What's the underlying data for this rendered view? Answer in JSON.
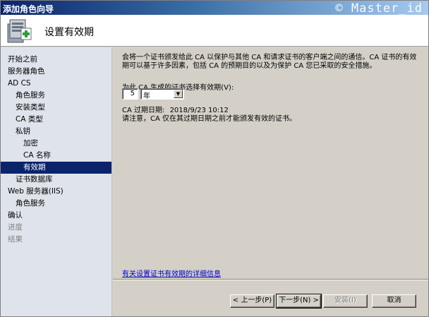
{
  "window": {
    "title": "添加角色向导",
    "watermark": "© Master_id"
  },
  "header": {
    "title": "设置有效期",
    "icon": "server-role-wizard-icon"
  },
  "nav": {
    "items": [
      {
        "label": "开始之前",
        "level": 0,
        "state": "normal"
      },
      {
        "label": "服务器角色",
        "level": 0,
        "state": "normal"
      },
      {
        "label": "AD CS",
        "level": 0,
        "state": "normal"
      },
      {
        "label": "角色服务",
        "level": 1,
        "state": "normal"
      },
      {
        "label": "安装类型",
        "level": 1,
        "state": "normal"
      },
      {
        "label": "CA 类型",
        "level": 1,
        "state": "normal"
      },
      {
        "label": "私钥",
        "level": 1,
        "state": "normal"
      },
      {
        "label": "加密",
        "level": 2,
        "state": "normal"
      },
      {
        "label": "CA 名称",
        "level": 2,
        "state": "normal"
      },
      {
        "label": "有效期",
        "level": 2,
        "state": "selected"
      },
      {
        "label": "证书数据库",
        "level": 1,
        "state": "normal"
      },
      {
        "label": "Web 服务器(IIS)",
        "level": 0,
        "state": "normal"
      },
      {
        "label": "角色服务",
        "level": 1,
        "state": "normal"
      },
      {
        "label": "确认",
        "level": 0,
        "state": "normal"
      },
      {
        "label": "进度",
        "level": 0,
        "state": "disabled"
      },
      {
        "label": "结果",
        "level": 0,
        "state": "disabled"
      }
    ]
  },
  "content": {
    "intro": "会将一个证书颁发给此 CA 以保护与其他 CA 和请求证书的客户端之间的通信。CA 证书的有效期可以基于许多因素，包括 CA 的预期目的以及为保护 CA 您已采取的安全措施。",
    "period_label": "为此 CA 生成的证书选择有效期(V):",
    "period_value": "5",
    "period_unit": "年",
    "expire_label": "CA 过期日期:",
    "expire_value": "2018/9/23 10:12",
    "note": "请注意，CA 仅在其过期日期之前才能颁发有效的证书。",
    "link": "有关设置证书有效期的详细信息"
  },
  "footer": {
    "back": "< 上一步(P)",
    "next": "下一步(N) >",
    "install": "安装(I)",
    "cancel": "取消"
  }
}
